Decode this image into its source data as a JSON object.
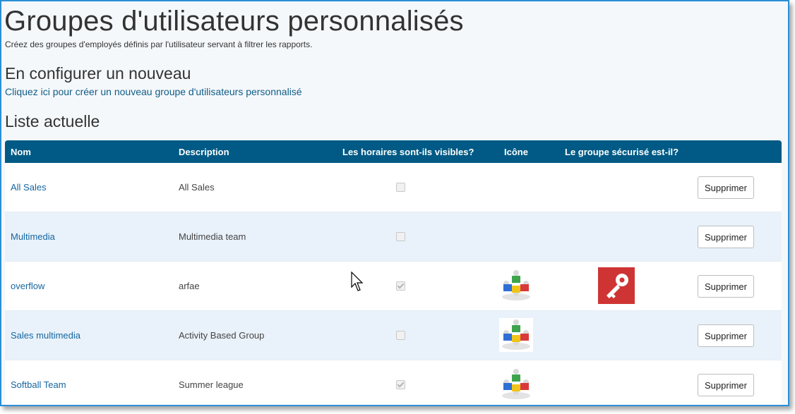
{
  "header": {
    "title": "Groupes d'utilisateurs personnalisés",
    "subtitle": "Créez des groupes d'employés définis par l'utilisateur servant à filtrer les rapports."
  },
  "create_section": {
    "heading": "En configurer un nouveau",
    "link": "Cliquez ici pour créer un nouveau groupe d'utilisateurs personnalisé"
  },
  "list_section": {
    "heading": "Liste actuelle"
  },
  "table": {
    "columns": [
      "Nom",
      "Description",
      "Les horaires sont-ils visibles?",
      "Icône",
      "Le groupe sécurisé est-il?"
    ],
    "rows": [
      {
        "name": "All Sales",
        "description": "All Sales",
        "schedules_visible": false,
        "icon": "",
        "secured_icon": "",
        "delete_label": "Supprimer"
      },
      {
        "name": "Multimedia",
        "description": "Multimedia team",
        "schedules_visible": false,
        "icon": "",
        "secured_icon": "",
        "delete_label": "Supprimer"
      },
      {
        "name": "overflow",
        "description": "arfae",
        "schedules_visible": true,
        "icon": "team-puzzle-icon",
        "secured_icon": "key-icon",
        "delete_label": "Supprimer"
      },
      {
        "name": "Sales multimedia",
        "description": "Activity Based Group",
        "schedules_visible": false,
        "icon": "team-puzzle-icon",
        "secured_icon": "",
        "delete_label": "Supprimer"
      },
      {
        "name": "Softball Team",
        "description": "Summer league",
        "schedules_visible": true,
        "icon": "team-puzzle-icon",
        "secured_icon": "",
        "delete_label": "Supprimer"
      }
    ]
  },
  "colors": {
    "header_bg": "#005a85",
    "link": "#1566a0",
    "alt_row": "#e9f2fa",
    "secure_red": "#cf3434"
  }
}
